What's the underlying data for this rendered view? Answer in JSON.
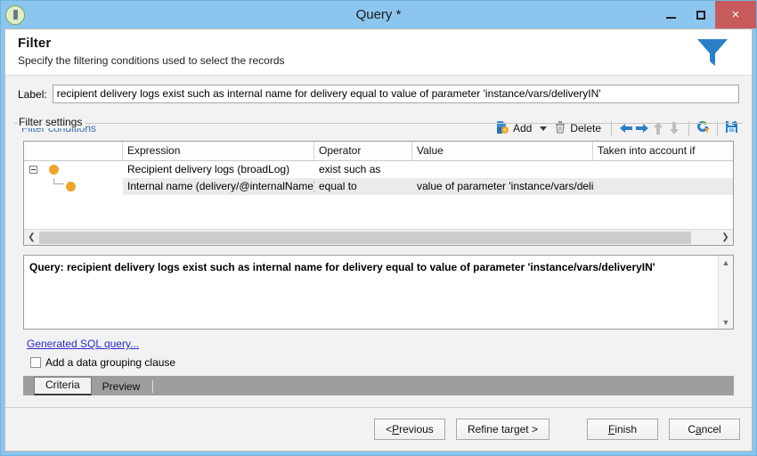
{
  "window": {
    "title": "Query *",
    "app_icon": "adobe-campaign-icon",
    "minimize_label": "Minimize",
    "maximize_label": "Maximize",
    "close_label": "×"
  },
  "header": {
    "title": "Filter",
    "subtitle": "Specify the filtering conditions used to select the records",
    "icon": "filter-funnel-icon",
    "icon_color": "#2a7fc9"
  },
  "label_field": {
    "caption": "Label:",
    "value": "recipient delivery logs exist such as internal name for delivery equal to value of parameter 'instance/vars/deliveryIN'"
  },
  "filter_settings": {
    "group_title": "Filter settings",
    "conditions_label": "Filter conditions"
  },
  "toolbar": {
    "add_label": "Add",
    "add_icon": "add-page-star-icon",
    "add_dropdown_icon": "chevron-down-icon",
    "delete_label": "Delete",
    "delete_icon": "trash-icon",
    "move_left_icon": "arrow-left-icon",
    "move_right_icon": "arrow-right-icon",
    "move_up_icon": "arrow-up-icon",
    "move_down_icon": "arrow-down-icon",
    "refresh_icon": "refresh-filter-icon",
    "save_icon": "floppy-save-icon"
  },
  "grid": {
    "columns": [
      "",
      "Expression",
      "Operator",
      "Value",
      "Taken into account if"
    ],
    "rows": [
      {
        "level": 1,
        "expander": "collapse",
        "expression": "Recipient delivery logs (broadLog)",
        "operator": "exist such as",
        "value": "",
        "taken_into_account_if": "",
        "selected": false
      },
      {
        "level": 2,
        "expander": "none",
        "expression": "Internal name (delivery/@internalName)",
        "operator": "equal to",
        "value": "value of parameter 'instance/vars/deliveryIN'",
        "taken_into_account_if": "",
        "selected": true
      }
    ],
    "scroll_left_icon": "chevron-left-icon",
    "scroll_right_icon": "chevron-right-icon"
  },
  "query_preview": {
    "text": "Query: recipient delivery logs exist such as internal name for delivery equal to value of parameter 'instance/vars/deliveryIN'",
    "scroll_up_icon": "caret-up-icon",
    "scroll_down_icon": "caret-down-icon"
  },
  "sql_link": {
    "label": "Generated SQL query...",
    "color": "#2a2ad0"
  },
  "grouping_checkbox": {
    "label": "Add a data grouping clause",
    "checked": false
  },
  "tabs": [
    {
      "label": "Criteria",
      "active": true
    },
    {
      "label": "Preview",
      "active": false
    }
  ],
  "footer_buttons": [
    {
      "label_pre": "< ",
      "mnemonic": "P",
      "label_post": "revious",
      "name": "previous-button"
    },
    {
      "label_pre": "Refine target >",
      "mnemonic": "",
      "label_post": "",
      "name": "refine-target-button"
    },
    {
      "label_pre": "",
      "mnemonic": "F",
      "label_post": "inish",
      "name": "finish-button"
    },
    {
      "label_pre": "C",
      "mnemonic": "a",
      "label_post": "ncel",
      "name": "cancel-button"
    }
  ]
}
